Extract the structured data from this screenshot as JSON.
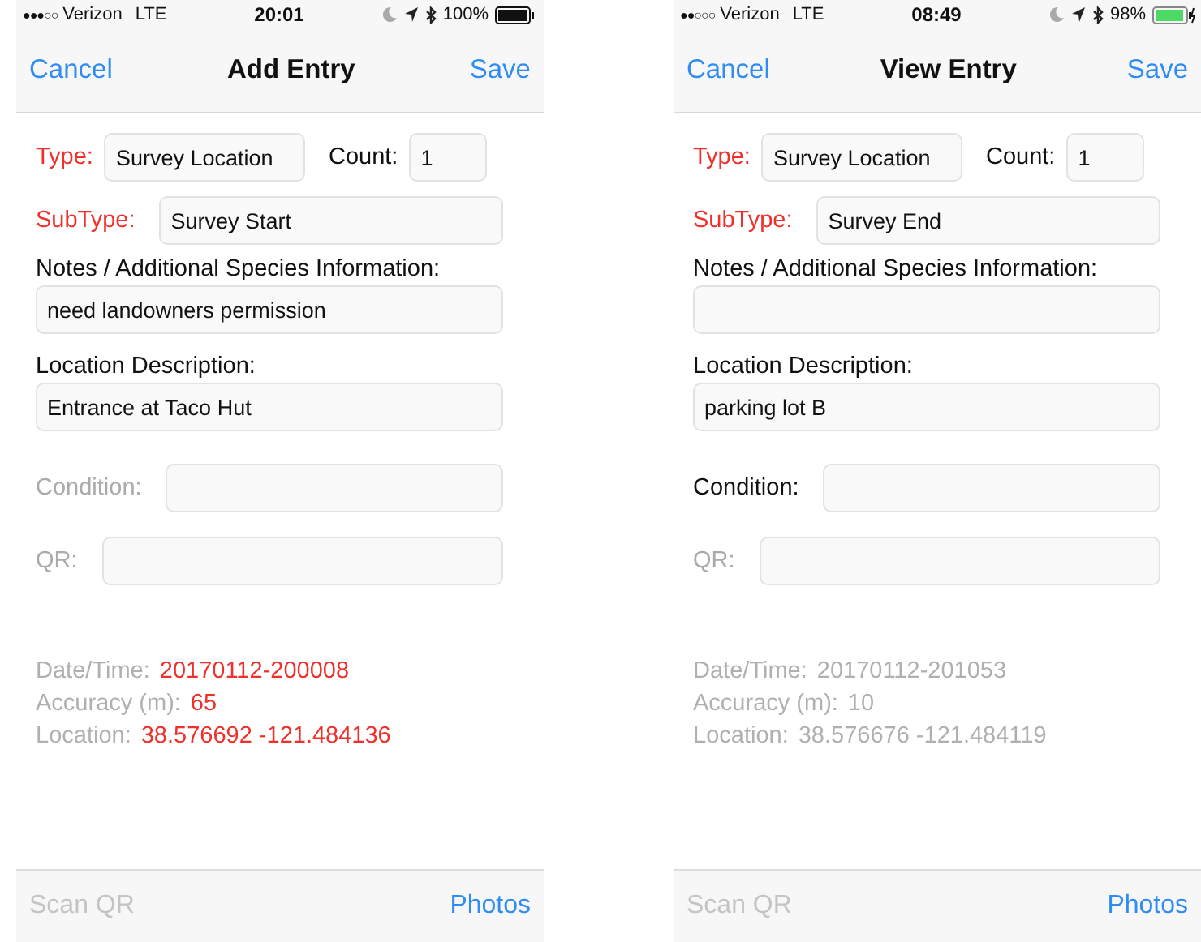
{
  "screens": [
    {
      "status_bar": {
        "signal": "●●●○○",
        "carrier": "Verizon",
        "network": "LTE",
        "time": "20:01",
        "battery_text": "100%",
        "charging": false
      },
      "nav": {
        "cancel": "Cancel",
        "title": "Add Entry",
        "save": "Save"
      },
      "form": [
        {
          "kind": "inline",
          "fields": [
            {
              "label": "Type:",
              "required": true,
              "disabled": false,
              "value": "Survey Location"
            },
            {
              "label": "Count:",
              "required": false,
              "disabled": false,
              "value": "1"
            }
          ]
        },
        {
          "kind": "inline",
          "fields": [
            {
              "label": "SubType:",
              "required": true,
              "disabled": false,
              "value": "Survey Start"
            }
          ]
        },
        {
          "kind": "stacked",
          "fields": [
            {
              "label": "Notes / Additional Species Information:",
              "required": false,
              "disabled": false,
              "value": "need landowners permission"
            }
          ]
        },
        {
          "kind": "stacked",
          "fields": [
            {
              "label": "Location Description:",
              "required": false,
              "disabled": false,
              "value": "Entrance at Taco Hut"
            }
          ]
        },
        {
          "kind": "inline",
          "fields": [
            {
              "label": "Condition:",
              "required": false,
              "disabled": true
            }
          ]
        },
        {
          "kind": "inline",
          "fields": [
            {
              "label": "QR:",
              "required": false,
              "disabled": true
            }
          ]
        }
      ],
      "info": [
        {
          "label": "Date/Time:",
          "value": "20170112-200008",
          "highlighted": true
        },
        {
          "label": "Accuracy (m):",
          "value": "65",
          "highlighted": true
        },
        {
          "label": "Location:",
          "value": "38.576692 -121.484136",
          "highlighted": true
        }
      ],
      "toolbar": {
        "scan": "Scan QR",
        "photos": "Photos"
      }
    },
    {
      "status_bar": {
        "signal": "●●○○○",
        "carrier": "Verizon",
        "network": "LTE",
        "time": "08:49",
        "battery_text": "98%",
        "charging": true
      },
      "nav": {
        "cancel": "Cancel",
        "title": "View Entry",
        "save": "Save"
      },
      "form": [
        {
          "kind": "inline",
          "fields": [
            {
              "label": "Type:",
              "required": true,
              "disabled": false,
              "value": "Survey Location"
            },
            {
              "label": "Count:",
              "required": false,
              "disabled": false,
              "value": "1"
            }
          ]
        },
        {
          "kind": "inline",
          "fields": [
            {
              "label": "SubType:",
              "required": true,
              "disabled": false,
              "value": "Survey End"
            }
          ]
        },
        {
          "kind": "stacked",
          "fields": [
            {
              "label": "Notes / Additional Species Information:",
              "required": false,
              "disabled": false
            }
          ]
        },
        {
          "kind": "stacked",
          "fields": [
            {
              "label": "Location Description:",
              "required": false,
              "disabled": false,
              "value": "parking lot B"
            }
          ]
        },
        {
          "kind": "inline",
          "fields": [
            {
              "label": "Condition:",
              "required": false,
              "disabled": false
            }
          ]
        },
        {
          "kind": "inline",
          "fields": [
            {
              "label": "QR:",
              "required": false,
              "disabled": true
            }
          ]
        }
      ],
      "info": [
        {
          "label": "Date/Time:",
          "value": "20170112-201053",
          "highlighted": false
        },
        {
          "label": "Accuracy (m):",
          "value": "10",
          "highlighted": false
        },
        {
          "label": "Location:",
          "value": "38.576676 -121.484119",
          "highlighted": false
        }
      ],
      "toolbar": {
        "scan": "Scan QR",
        "photos": "Photos"
      }
    }
  ]
}
